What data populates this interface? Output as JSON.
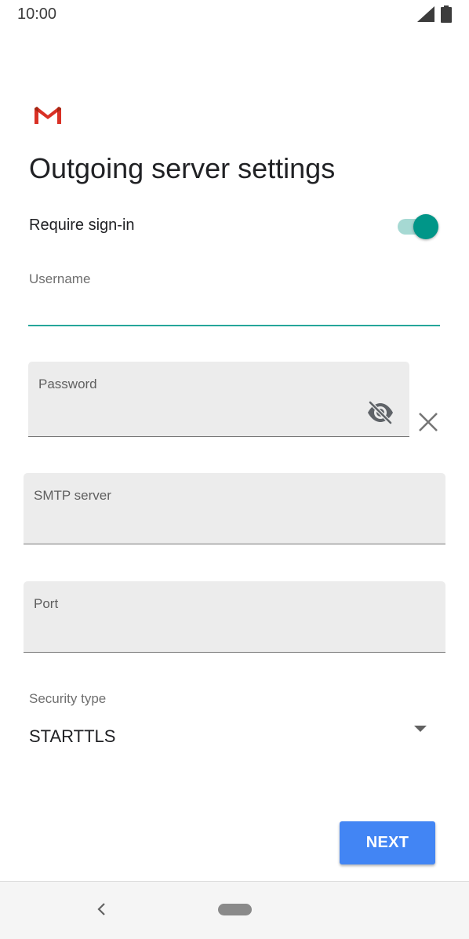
{
  "status_bar": {
    "time": "10:00",
    "icons": [
      "signal-icon",
      "battery-icon"
    ]
  },
  "header": {
    "logo": "gmail-logo",
    "title": "Outgoing server settings"
  },
  "require_signin": {
    "label": "Require sign-in",
    "enabled": true
  },
  "fields": {
    "username": {
      "label": "Username",
      "value": ""
    },
    "password": {
      "label": "Password",
      "value": ""
    },
    "smtp_server": {
      "label": "SMTP server",
      "value": ""
    },
    "port": {
      "label": "Port",
      "value": ""
    }
  },
  "security": {
    "label": "Security type",
    "selected": "STARTTLS"
  },
  "actions": {
    "next_label": "NEXT"
  },
  "colors": {
    "accent_teal": "#009688",
    "button_blue": "#4285f4"
  },
  "nav": {
    "icons": [
      "back-icon",
      "home-pill"
    ]
  }
}
